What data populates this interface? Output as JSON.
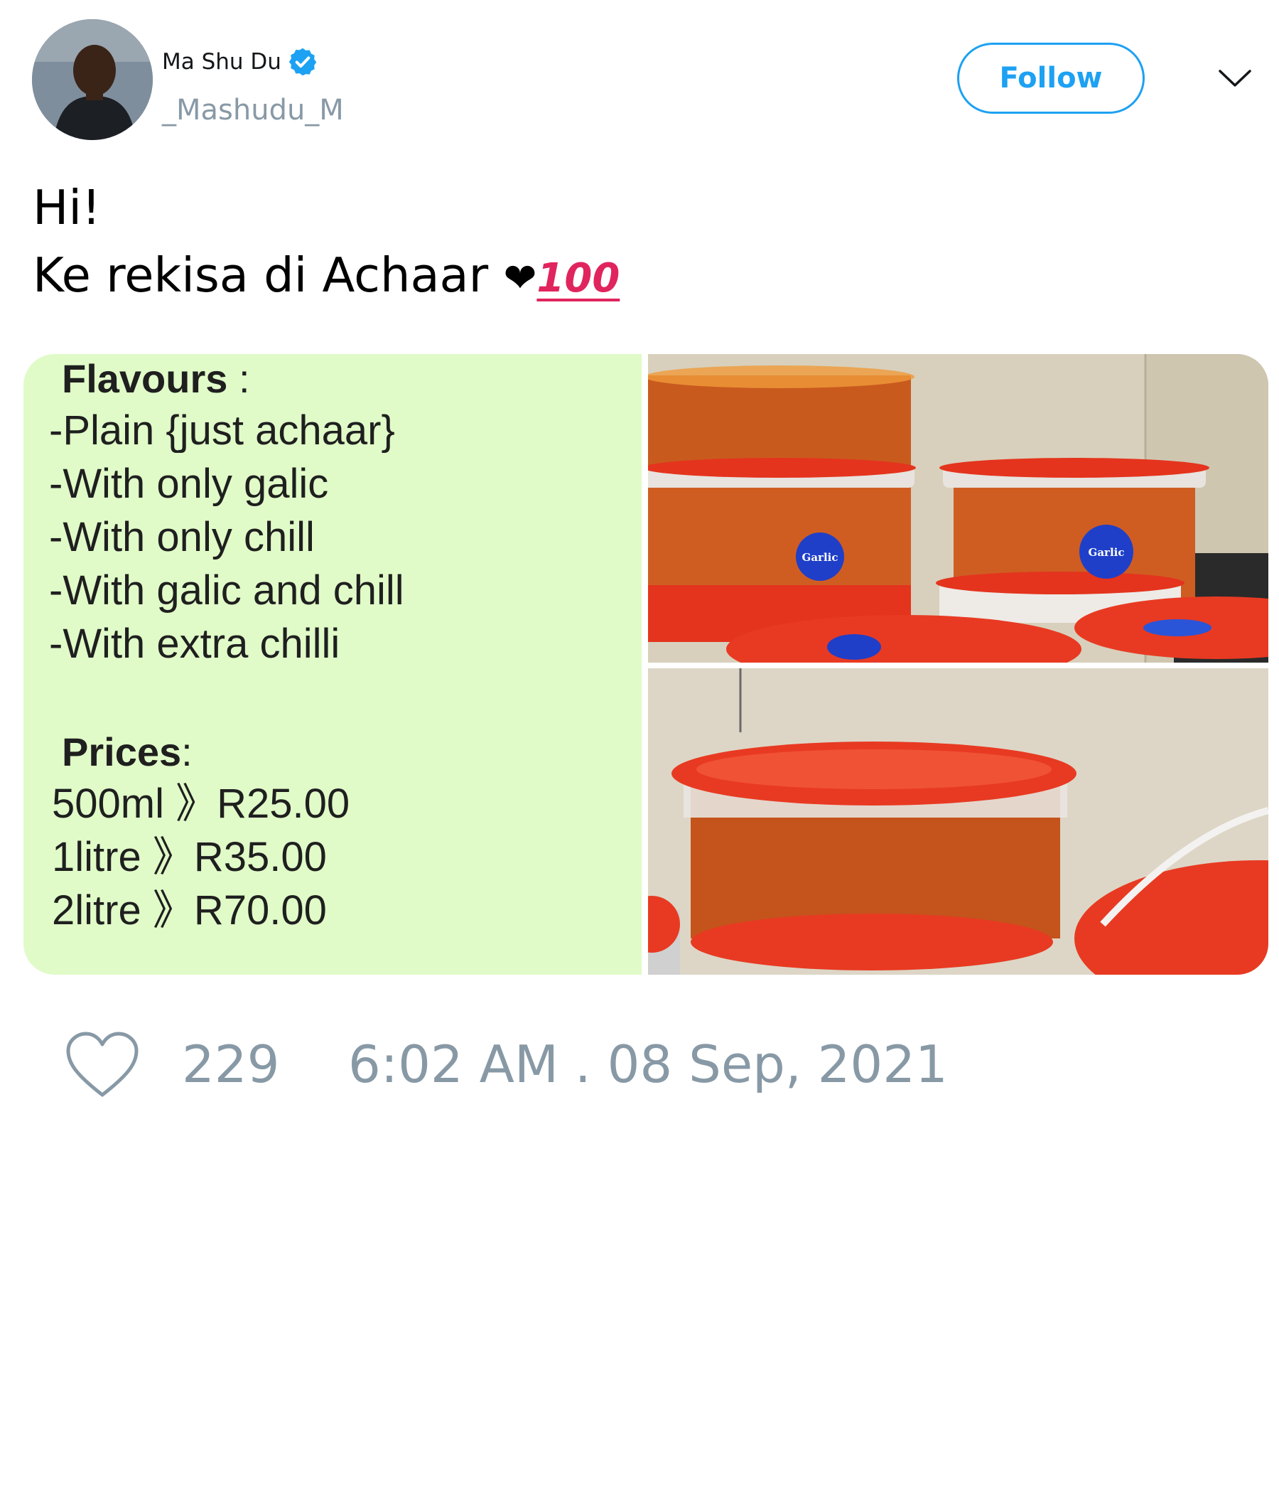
{
  "author": {
    "display_name": "Ma Shu Du",
    "handle": "_Mashudu_M",
    "verified": true
  },
  "header": {
    "follow_label": "Follow",
    "menu_icon": "chevron-down-icon"
  },
  "tweet": {
    "lines": [
      "Hi!",
      "Ke rekisa di Achaar"
    ],
    "emoji": [
      "❤",
      "💯"
    ]
  },
  "media": {
    "flavours_heading": "Flavours",
    "flavours_colon": " :",
    "flavours": [
      "-Plain {just achaar}",
      "-With only galic",
      "-With only chill",
      "-With galic and chill",
      "-With extra chilli"
    ],
    "prices_heading": "Prices",
    "prices_colon": ":",
    "prices": [
      "500ml 》R25.00",
      "1litre 》R35.00",
      "2litre 》R70.00"
    ],
    "label_text": "Garlic"
  },
  "footer": {
    "like_icon": "heart-icon",
    "like_count": "229",
    "timestamp": "6:02 AM . 08 Sep, 2021"
  },
  "colors": {
    "brand_blue": "#1da1f2",
    "muted_gray": "#8899a6",
    "panel_green": "#e0fbc8",
    "lid_red": "#e83a22"
  }
}
